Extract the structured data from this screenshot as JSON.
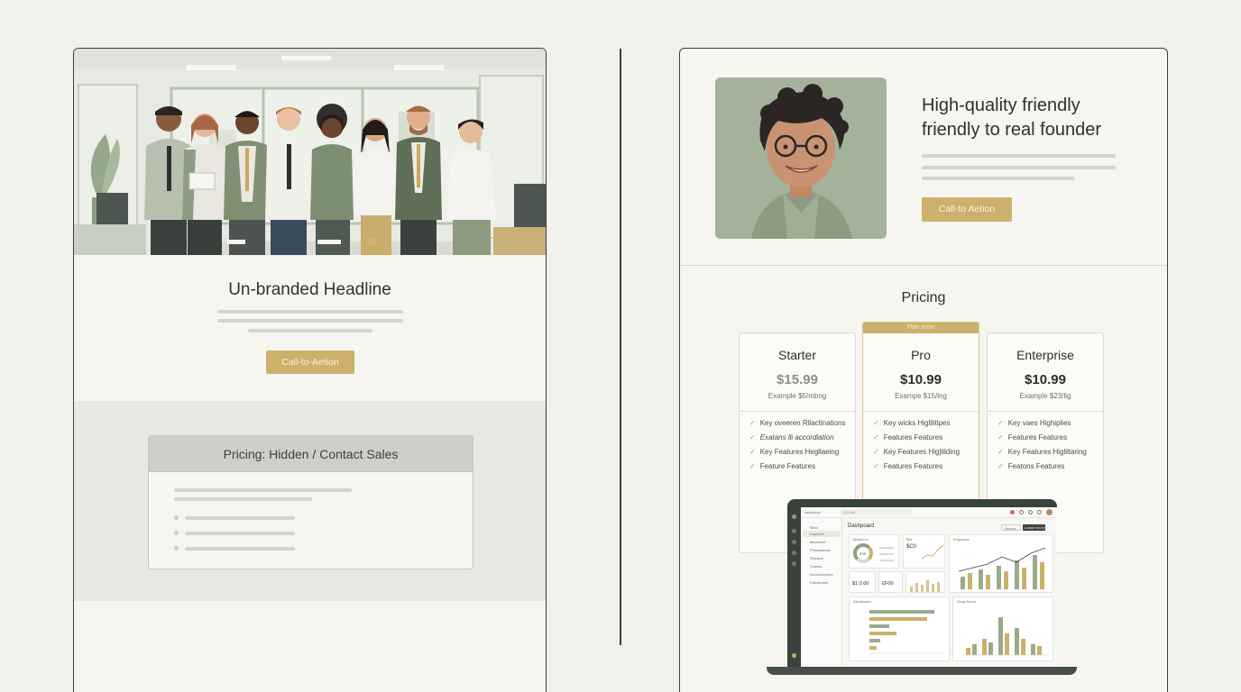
{
  "left": {
    "headline": "Un-branded Headline",
    "cta_label": "Call-to-Aetion",
    "pricing_hidden": "Pricing: Hidden / Contact Sales"
  },
  "right": {
    "headline_line1": "High-quality friendly",
    "headline_line2": "friendly to real founder",
    "cta_label": "Call-to Aetion",
    "pricing_title": "Pricing",
    "plans": [
      {
        "name": "Starter",
        "price": "$15.99",
        "sub": "Example $5/mbng",
        "features": [
          "Key oveeren Rllactinations",
          "Exatans lli accordiation",
          "Key Features Hegllaeing",
          "Feature Features"
        ]
      },
      {
        "name": "Pro",
        "badge": "Plan reow",
        "price": "$10.99",
        "sub": "Exampe $15/lng",
        "features": [
          "Key wicks Higlilitipes",
          "Features Features",
          "Key Features Hig|lilding",
          "Features Features"
        ]
      },
      {
        "name": "Enterprise",
        "price": "$10.99",
        "sub": "Example $23/lig",
        "features": [
          "Key vaes Highiplies",
          "Features Features",
          "Key Features Higliltaring",
          "Featons Features"
        ]
      }
    ],
    "dashboard": {
      "title": "Dashpoard",
      "search_placeholder": "Q Draa",
      "app_name": "swodlauni",
      "kpi1_label": "Sionst Inn",
      "kpi1_value": "378",
      "kpi2_label": "Bto",
      "kpi2_value": "$C0",
      "kpi3_value": "$1.0.00",
      "kpi4_value": "£F00",
      "chart_label": "Empoiose",
      "bar_label": "Ailsrtionant",
      "bar2_label": "Sergi Nocet",
      "btn_label": "Hetove",
      "btn2_label": "Laswt Innovt",
      "side_items": [
        "Bilhd",
        "Eapivont",
        "Bieyewhit",
        "Prioswdinals",
        "Reawue",
        "Trabets",
        "Sa bobbvodne",
        "Pasmbrites"
      ]
    },
    "colors": {
      "accent": "#cdb06a",
      "sage": "#8f9e7f",
      "dark": "#3a423c"
    }
  }
}
